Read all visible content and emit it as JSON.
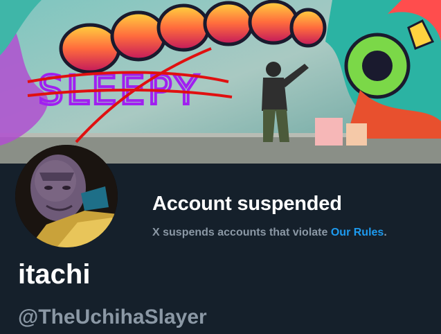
{
  "banner": {
    "graffiti_text": "SLEEPY",
    "graffiti_logo_icon": "graffiti-wall-icon"
  },
  "avatar": {
    "icon": "profile-avatar-icon"
  },
  "suspension": {
    "title": "Account suspended",
    "message_prefix": "X suspends accounts that violate ",
    "rules_link": "Our Rules",
    "message_suffix": "."
  },
  "profile": {
    "display_name": "itachi",
    "handle": "@TheUchihaSlayer"
  },
  "colors": {
    "background": "#15202b",
    "link": "#1d9bf0",
    "secondary_text": "#8b98a5"
  }
}
